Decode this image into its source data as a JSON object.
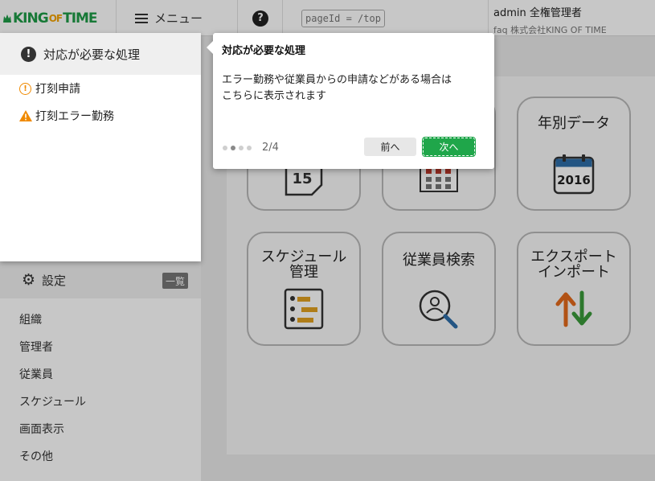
{
  "header": {
    "logo_main": "KING",
    "logo_of": "OF",
    "logo_time": "TIME",
    "menu_label": "メニュー",
    "help_glyph": "?",
    "page_id": "pageId = /top",
    "user_line1": "admin 全権管理者",
    "user_line2": "faq 株式会社KING OF TIME"
  },
  "alert_panel": {
    "title": "対応が必要な処理",
    "title_icon": "exclamation-circle-icon",
    "items": [
      {
        "label": "打刻申請",
        "icon": "warning-circle-icon"
      },
      {
        "label": "打刻エラー勤務",
        "icon": "warning-triangle-icon"
      }
    ]
  },
  "settings": {
    "title": "設定",
    "icon": "gear-icon",
    "list_badge": "一覧",
    "items": [
      "組織",
      "管理者",
      "従業員",
      "スケジュール",
      "画面表示",
      "その他"
    ]
  },
  "tiles": [
    {
      "label": "年別データ",
      "icon": "calendar-2016-icon",
      "year": "2016"
    },
    {
      "label": "スケジュール管理",
      "line1": "スケジュール",
      "line2": "管理",
      "icon": "schedule-list-icon"
    },
    {
      "label": "従業員検索",
      "icon": "person-search-icon"
    },
    {
      "label": "エクスポートインポート",
      "line1": "エクスポート",
      "line2": "インポート",
      "icon": "up-down-arrows-icon"
    }
  ],
  "hidden_tile_day": "15",
  "popover": {
    "title": "対応が必要な処理",
    "body_line1": "エラー勤務や従業員からの申請などがある場合は",
    "body_line2": "こちらに表示されます",
    "pager": "2/4",
    "step_current": 2,
    "step_total": 4,
    "prev_label": "前へ",
    "next_label": "次へ"
  },
  "colors": {
    "brand_green": "#1e9c47",
    "brand_orange": "#f3a200",
    "next_button": "#1fa64a",
    "warning": "#f08a00"
  }
}
